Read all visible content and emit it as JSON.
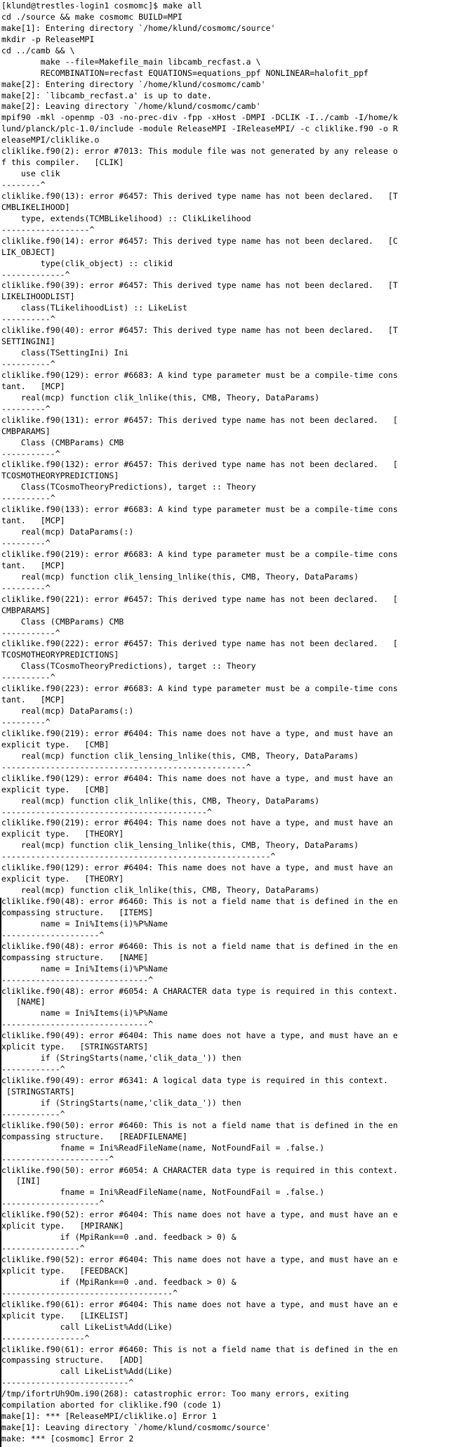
{
  "terminal": {
    "lines": [
      "[klund@trestles-login1 cosmomc]$ make all",
      "cd ./source && make cosmomc BUILD=MPI",
      "make[1]: Entering directory `/home/klund/cosmomc/source'",
      "mkdir -p ReleaseMPI",
      "cd ../camb && \\",
      "        make --file=Makefile_main libcamb_recfast.a \\",
      "        RECOMBINATION=recfast EQUATIONS=equations_ppf NONLINEAR=halofit_ppf",
      "make[2]: Entering directory `/home/klund/cosmomc/camb'",
      "make[2]: `libcamb_recfast.a' is up to date.",
      "make[2]: Leaving directory `/home/klund/cosmomc/camb'",
      "mpif90 -mkl -openmp -O3 -no-prec-div -fpp -xHost -DMPI -DCLIK -I../camb -I/home/k",
      "lund/planck/plc-1.0/include -module ReleaseMPI -IReleaseMPI/ -c cliklike.f90 -o R",
      "eleaseMPI/cliklike.o",
      "cliklike.f90(2): error #7013: This module file was not generated by any release o",
      "f this compiler.   [CLIK]",
      "    use clik",
      "--------^",
      "cliklike.f90(13): error #6457: This derived type name has not been declared.   [T",
      "CMBLIKELIHOOD]",
      "    type, extends(TCMBLikelihood) :: ClikLikelihood",
      "------------------^",
      "cliklike.f90(14): error #6457: This derived type name has not been declared.   [C",
      "LIK_OBJECT]",
      "        type(clik_object) :: clikid",
      "-------------^",
      "cliklike.f90(39): error #6457: This derived type name has not been declared.   [T",
      "LIKELIHOODLIST]",
      "    class(TLikelihoodList) :: LikeList",
      "----------^",
      "cliklike.f90(40): error #6457: This derived type name has not been declared.   [T",
      "SETTINGINI]",
      "    class(TSettingIni) Ini",
      "----------^",
      "cliklike.f90(129): error #6683: A kind type parameter must be a compile-time cons",
      "tant.   [MCP]",
      "    real(mcp) function clik_lnlike(this, CMB, Theory, DataParams)",
      "---------^",
      "cliklike.f90(131): error #6457: This derived type name has not been declared.   [",
      "CMBPARAMS]",
      "    Class (CMBParams) CMB",
      "-----------^",
      "cliklike.f90(132): error #6457: This derived type name has not been declared.   [",
      "TCOSMOTHEORYPREDICTIONS]",
      "    Class(TCosmoTheoryPredictions), target :: Theory",
      "----------^",
      "cliklike.f90(133): error #6683: A kind type parameter must be a compile-time cons",
      "tant.   [MCP]",
      "    real(mcp) DataParams(:)",
      "---------^",
      "cliklike.f90(219): error #6683: A kind type parameter must be a compile-time cons",
      "tant.   [MCP]",
      "    real(mcp) function clik_lensing_lnlike(this, CMB, Theory, DataParams)",
      "---------^",
      "cliklike.f90(221): error #6457: This derived type name has not been declared.   [",
      "CMBPARAMS]",
      "    Class (CMBParams) CMB",
      "-----------^",
      "cliklike.f90(222): error #6457: This derived type name has not been declared.   [",
      "TCOSMOTHEORYPREDICTIONS]",
      "    Class(TCosmoTheoryPredictions), target :: Theory",
      "----------^",
      "cliklike.f90(223): error #6683: A kind type parameter must be a compile-time cons",
      "tant.   [MCP]",
      "    real(mcp) DataParams(:)",
      "---------^",
      "cliklike.f90(219): error #6404: This name does not have a type, and must have an",
      "explicit type.   [CMB]",
      "    real(mcp) function clik_lensing_lnlike(this, CMB, Theory, DataParams)",
      "--------------------------------------------------^",
      "cliklike.f90(129): error #6404: This name does not have a type, and must have an",
      "explicit type.   [CMB]",
      "    real(mcp) function clik_lnlike(this, CMB, Theory, DataParams)",
      "------------------------------------------^",
      "cliklike.f90(219): error #6404: This name does not have a type, and must have an",
      "explicit type.   [THEORY]",
      "    real(mcp) function clik_lensing_lnlike(this, CMB, Theory, DataParams)",
      "-------------------------------------------------------^",
      "cliklike.f90(129): error #6404: This name does not have a type, and must have an",
      "explicit type.   [THEORY]",
      "    real(mcp) function clik_lnlike(this, CMB, Theory, DataParams)",
      "cliklike.f90(48): error #6460: This is not a field name that is defined in the en",
      "compassing structure.   [ITEMS]",
      "        name = Ini%Items(i)%P%Name",
      "--------------------^",
      "cliklike.f90(48): error #6460: This is not a field name that is defined in the en",
      "compassing structure.   [NAME]",
      "        name = Ini%Items(i)%P%Name",
      "------------------------------^",
      "cliklike.f90(48): error #6054: A CHARACTER data type is required in this context.",
      "   [NAME]",
      "        name = Ini%Items(i)%P%Name",
      "------------------------------^",
      "cliklike.f90(49): error #6404: This name does not have a type, and must have an e",
      "xplicit type.   [STRINGSTARTS]",
      "        if (StringStarts(name,'clik_data_')) then",
      "------------^",
      "cliklike.f90(49): error #6341: A logical data type is required in this context.",
      " [STRINGSTARTS]",
      "        if (StringStarts(name,'clik_data_')) then",
      "------------^",
      "cliklike.f90(50): error #6460: This is not a field name that is defined in the en",
      "compassing structure.   [READFILENAME]",
      "            fname = Ini%ReadFileName(name, NotFoundFail = .false.)",
      "----------------------^",
      "cliklike.f90(50): error #6054: A CHARACTER data type is required in this context.",
      "   [INI]",
      "            fname = Ini%ReadFileName(name, NotFoundFail = .false.)",
      "--------------------^",
      "cliklike.f90(52): error #6404: This name does not have a type, and must have an e",
      "xplicit type.   [MPIRANK]",
      "            if (MpiRank==0 .and. feedback > 0) &",
      "----------------^",
      "cliklike.f90(52): error #6404: This name does not have a type, and must have an e",
      "xplicit type.   [FEEDBACK]",
      "            if (MpiRank==0 .and. feedback > 0) &",
      "-----------------------------------^",
      "cliklike.f90(61): error #6404: This name does not have a type, and must have an e",
      "xplicit type.   [LIKELIST]",
      "            call LikeList%Add(Like)",
      "-----------------^",
      "cliklike.f90(61): error #6460: This is not a field name that is defined in the en",
      "compassing structure.   [ADD]",
      "            call LikeList%Add(Like)",
      "--------------------------^",
      "/tmp/ifortrUh9Om.i90(268): catastrophic error: Too many errors, exiting",
      "compilation aborted for cliklike.f90 (code 1)",
      "make[1]: *** [ReleaseMPI/cliklike.o] Error 1",
      "make[1]: Leaving directory `/home/klund/cosmomc/source'",
      "make: *** [cosmomc] Error 2"
    ]
  }
}
